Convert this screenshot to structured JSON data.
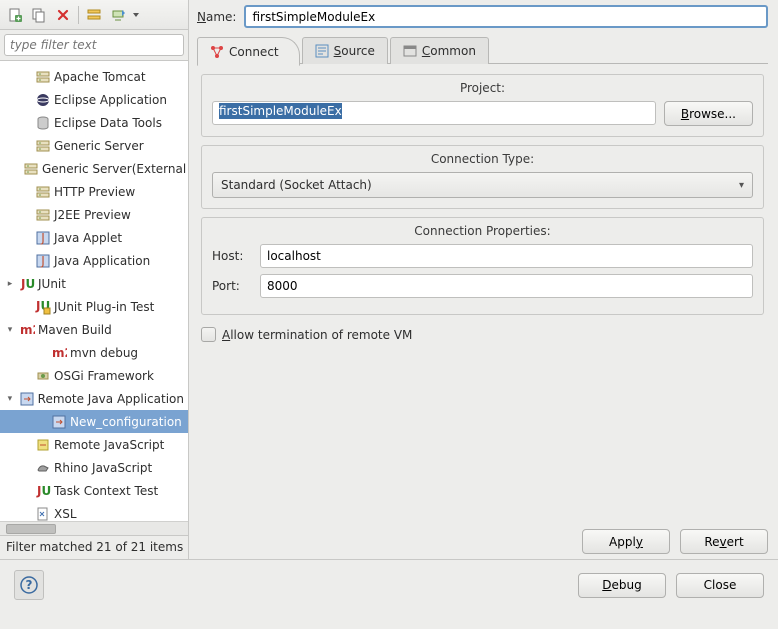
{
  "toolbar": {
    "new_icon": "new-config-icon",
    "dup_icon": "duplicate-icon",
    "del_icon": "delete-icon",
    "col_icon": "collapse-all-icon",
    "run_icon": "filter-icon"
  },
  "filter": {
    "placeholder": "type filter text"
  },
  "tree": {
    "items": [
      {
        "label": "Apache Tomcat",
        "exp": "",
        "icon": "server",
        "depth": 1
      },
      {
        "label": "Eclipse Application",
        "exp": "",
        "icon": "eclipse",
        "depth": 1
      },
      {
        "label": "Eclipse Data Tools",
        "exp": "",
        "icon": "db",
        "depth": 1
      },
      {
        "label": "Generic Server",
        "exp": "",
        "icon": "server",
        "depth": 1
      },
      {
        "label": "Generic Server(External Launch)",
        "exp": "",
        "icon": "server",
        "depth": 1
      },
      {
        "label": "HTTP Preview",
        "exp": "",
        "icon": "server",
        "depth": 1
      },
      {
        "label": "J2EE Preview",
        "exp": "",
        "icon": "server",
        "depth": 1
      },
      {
        "label": "Java Applet",
        "exp": "",
        "icon": "applet",
        "depth": 1
      },
      {
        "label": "Java Application",
        "exp": "",
        "icon": "java",
        "depth": 1
      },
      {
        "label": "JUnit",
        "exp": ">",
        "icon": "junit",
        "depth": 0
      },
      {
        "label": "JUnit Plug-in Test",
        "exp": "",
        "icon": "junit-plug",
        "depth": 1
      },
      {
        "label": "Maven Build",
        "exp": "v",
        "icon": "m2",
        "depth": 0
      },
      {
        "label": "mvn debug",
        "exp": "",
        "icon": "m2",
        "depth": 2
      },
      {
        "label": "OSGi Framework",
        "exp": "",
        "icon": "osgi",
        "depth": 1
      },
      {
        "label": "Remote Java Application",
        "exp": "v",
        "icon": "remote",
        "depth": 0
      },
      {
        "label": "New_configuration",
        "exp": "",
        "icon": "remote",
        "depth": 2,
        "selected": true
      },
      {
        "label": "Remote JavaScript",
        "exp": "",
        "icon": "js",
        "depth": 1
      },
      {
        "label": "Rhino JavaScript",
        "exp": "",
        "icon": "rhino",
        "depth": 1
      },
      {
        "label": "Task Context Test",
        "exp": "",
        "icon": "junit",
        "depth": 1
      },
      {
        "label": "XSL",
        "exp": "",
        "icon": "xsl",
        "depth": 1
      }
    ]
  },
  "filter_status": "Filter matched 21 of 21 items",
  "name": {
    "label": "Name:",
    "value": "firstSimpleModuleEx"
  },
  "tabs": {
    "connect": "Connect",
    "source": "Source",
    "common": "Common"
  },
  "project": {
    "title": "Project:",
    "value": "firstSimpleModuleEx",
    "browse": "Browse..."
  },
  "conntype": {
    "title": "Connection Type:",
    "value": "Standard (Socket Attach)"
  },
  "connprops": {
    "title": "Connection Properties:",
    "host_label": "Host:",
    "host_value": "localhost",
    "port_label": "Port:",
    "port_value": "8000"
  },
  "allow_term": "Allow termination of remote VM",
  "buttons": {
    "apply": "Apply",
    "revert": "Revert",
    "debug": "Debug",
    "close": "Close"
  }
}
